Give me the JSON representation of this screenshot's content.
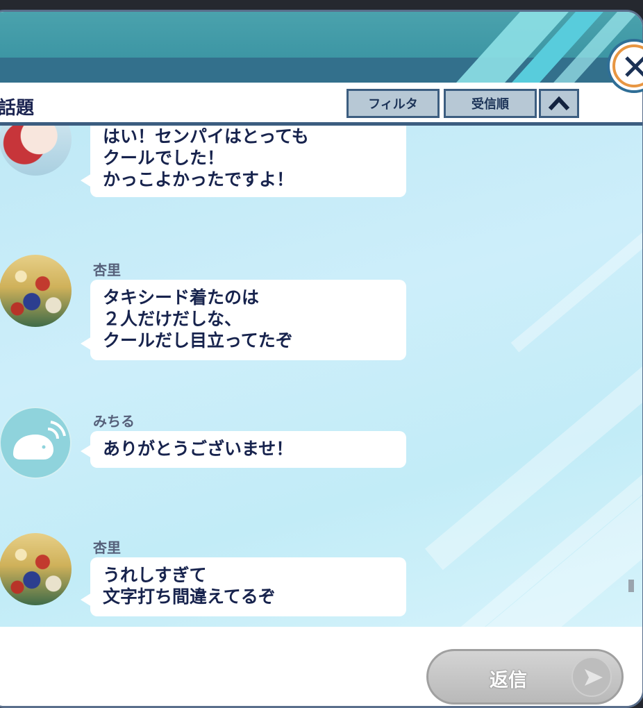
{
  "header": {
    "title": "話題"
  },
  "toolbar": {
    "filter_label": "フィルタ",
    "order_label": "受信順"
  },
  "messages": [
    {
      "sender": "",
      "text": "はい！センパイはとっても\nクールでした！\nかっこよかったですよ！",
      "avatar": "red-haired-girl"
    },
    {
      "sender": "杏里",
      "text": "タキシード着たのは\n２人だけだしな、\nクールだし目立ってたぞ",
      "avatar": "casino-chips"
    },
    {
      "sender": "みちる",
      "text": "ありがとうございませ！",
      "avatar": "whale-icon"
    },
    {
      "sender": "杏里",
      "text": "うれしすぎて\n文字打ち間違えてるぞ",
      "avatar": "casino-chips"
    }
  ],
  "footer": {
    "reply_label": "返信"
  },
  "colors": {
    "header_teal": "#4aa2ad",
    "header_navy": "#33708c",
    "text_navy": "#17234d",
    "close_ring": "#e89642"
  }
}
